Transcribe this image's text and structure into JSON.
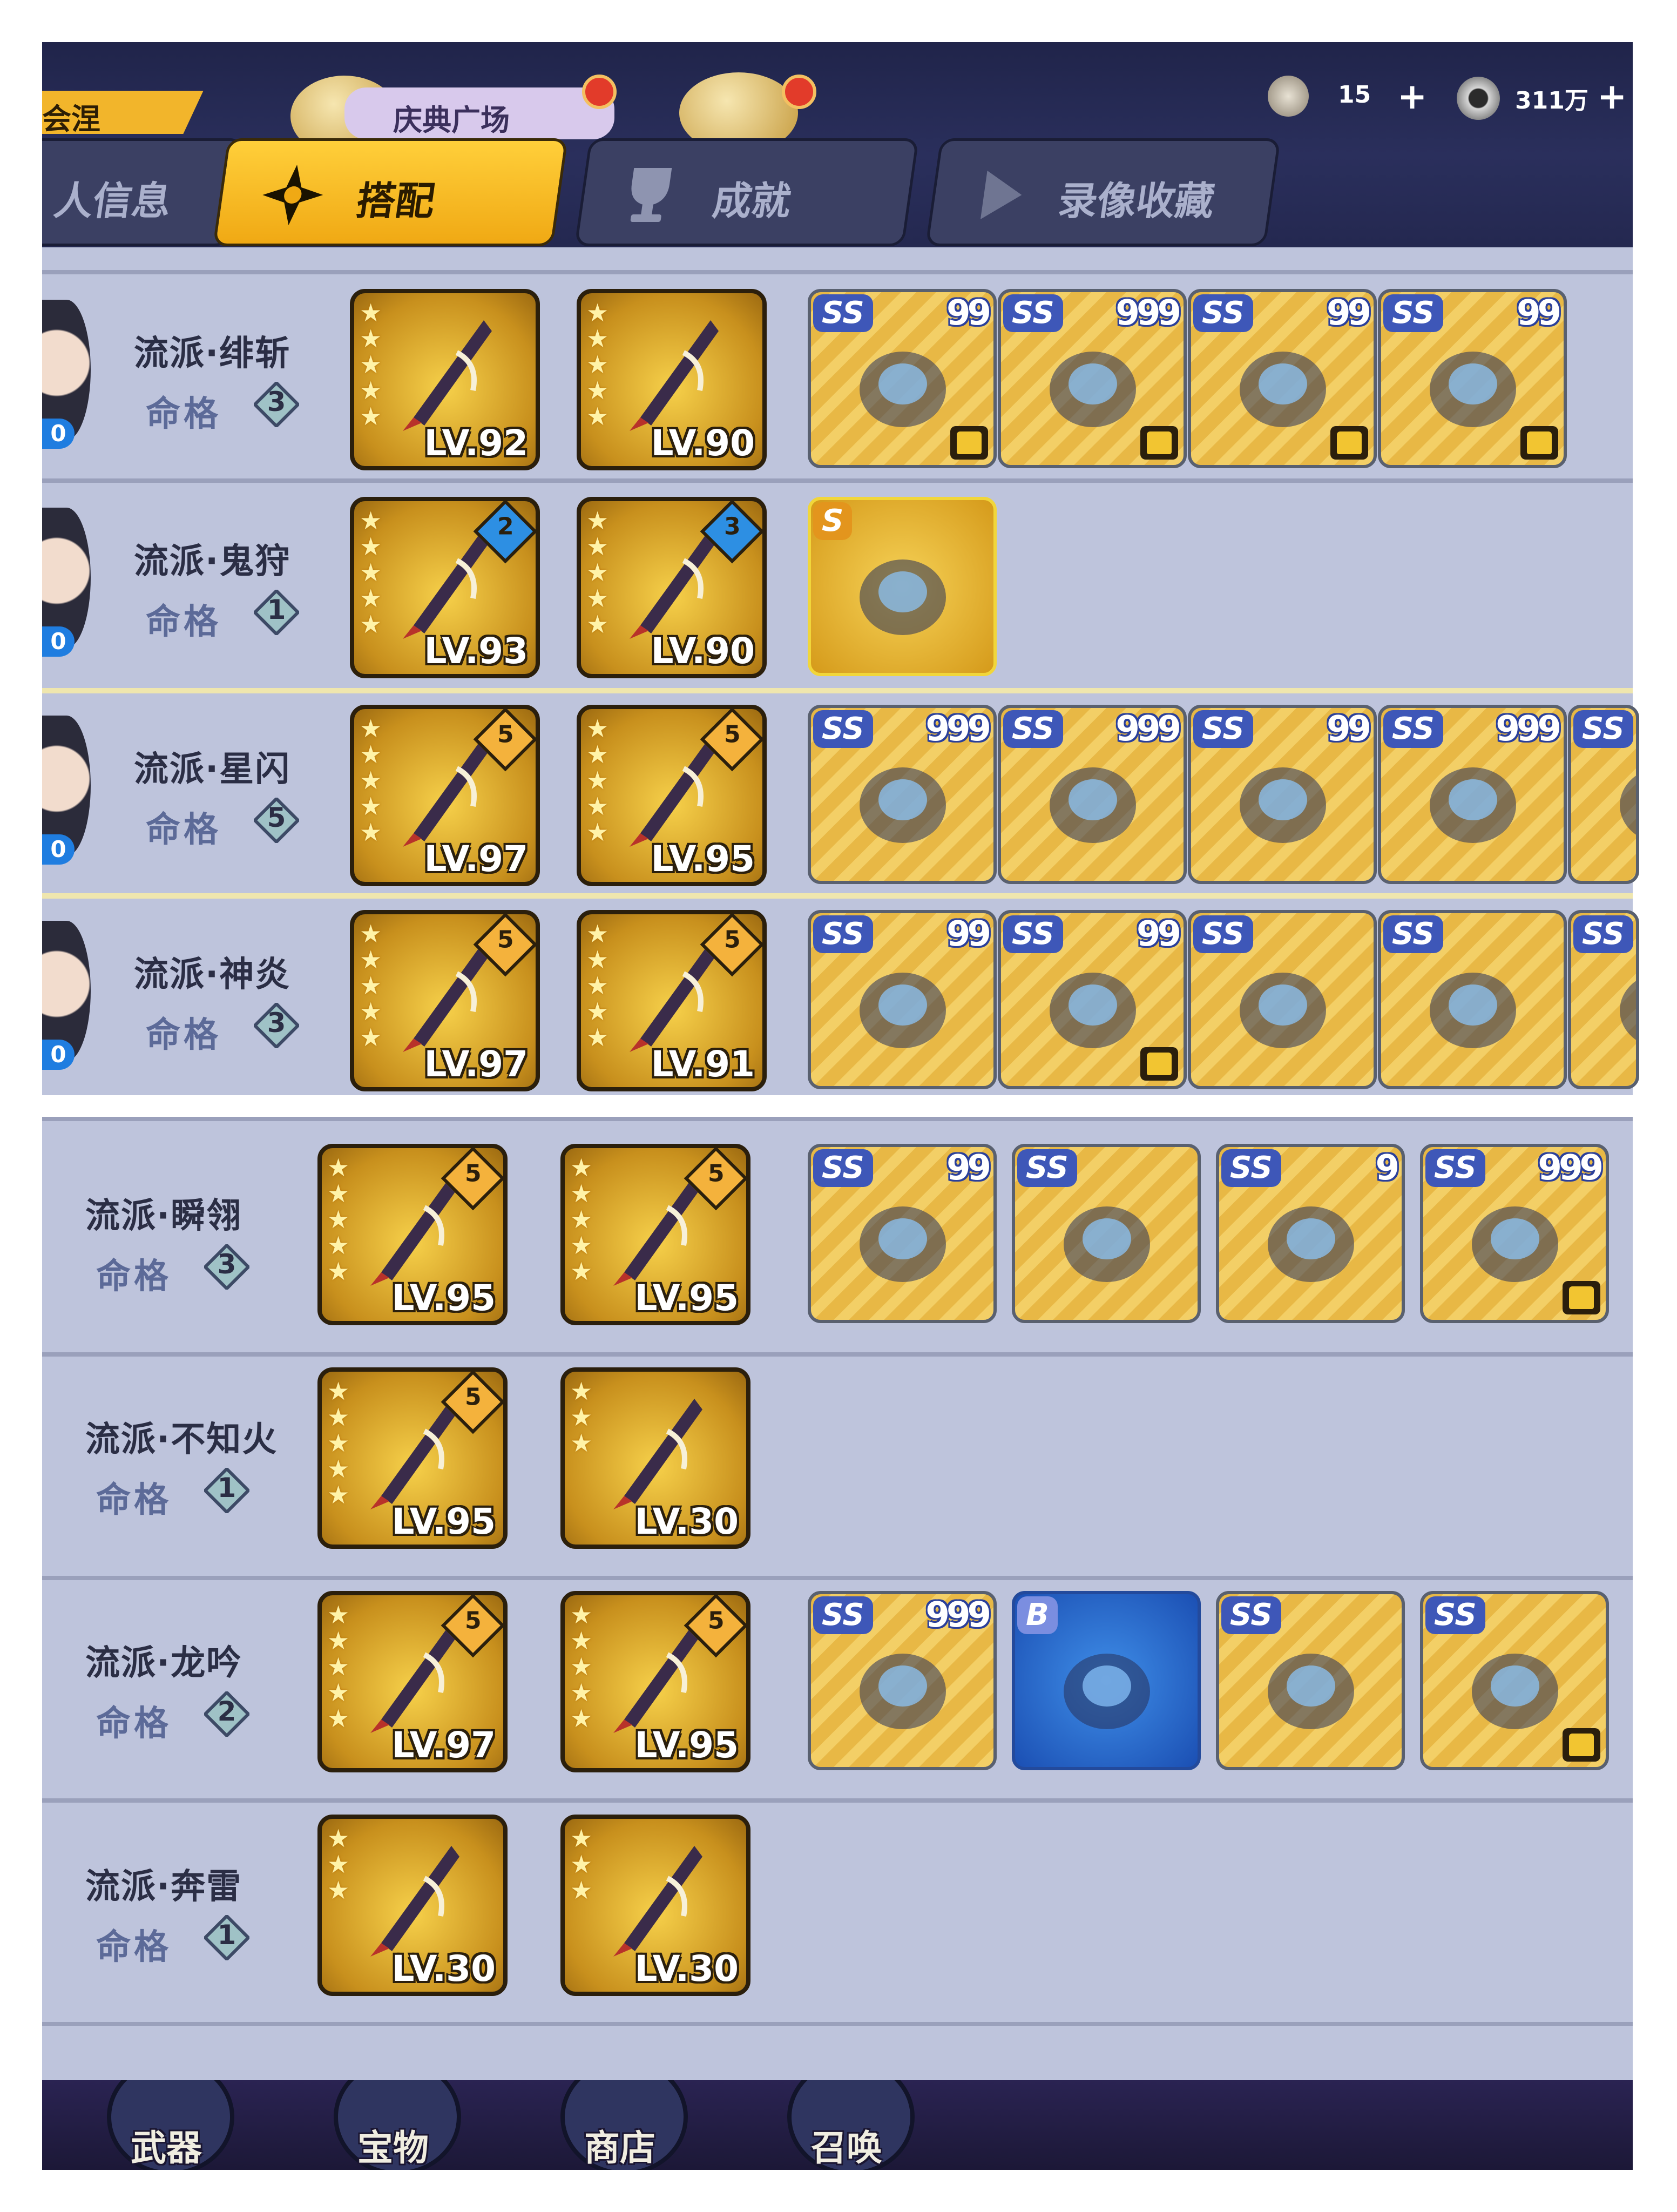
{
  "header": {
    "left_banner_text": "会涅",
    "banner_text": "庆典广场",
    "resources": [
      {
        "icon": "gem-bag-icon",
        "value": "15"
      },
      {
        "icon": "coin-icon",
        "value": "311万"
      }
    ],
    "tabs": [
      {
        "label": "人信息",
        "icon": "person-info-icon",
        "active": false
      },
      {
        "label": "搭配",
        "icon": "shuriken-icon",
        "active": true
      },
      {
        "label": "成就",
        "icon": "trophy-icon",
        "active": false
      },
      {
        "label": "录像收藏",
        "icon": "play-icon",
        "active": false
      }
    ]
  },
  "top_rows": [
    {
      "school": "流派·绯斩",
      "mingge_label": "命格",
      "mingge": "3",
      "portrait_badge": "0",
      "weapons": [
        {
          "stars": 5,
          "level": "LV.92",
          "grade": ""
        },
        {
          "stars": 5,
          "level": "LV.90",
          "grade": ""
        }
      ],
      "items": [
        {
          "grade": "SS",
          "count": "99",
          "shirt": true
        },
        {
          "grade": "SS",
          "count": "999",
          "shirt": true
        },
        {
          "grade": "SS",
          "count": "99",
          "shirt": true
        },
        {
          "grade": "SS",
          "count": "99",
          "shirt": true
        }
      ]
    },
    {
      "school": "流派·鬼狩",
      "mingge_label": "命格",
      "mingge": "1",
      "portrait_badge": "0",
      "weapons": [
        {
          "stars": 5,
          "level": "LV.93",
          "grade": "2"
        },
        {
          "stars": 5,
          "level": "LV.90",
          "grade": "3"
        }
      ],
      "items": [
        {
          "grade": "S",
          "count": "",
          "shirt": false
        }
      ]
    },
    {
      "school": "流派·星闪",
      "mingge_label": "命格",
      "mingge": "5",
      "portrait_badge": "0",
      "weapons": [
        {
          "stars": 5,
          "level": "LV.97",
          "grade": "5"
        },
        {
          "stars": 5,
          "level": "LV.95",
          "grade": "5"
        }
      ],
      "items": [
        {
          "grade": "SS",
          "count": "999",
          "shirt": false
        },
        {
          "grade": "SS",
          "count": "999",
          "shirt": false
        },
        {
          "grade": "SS",
          "count": "99",
          "shirt": false
        },
        {
          "grade": "SS",
          "count": "999",
          "shirt": false
        },
        {
          "grade": "SS",
          "count": "",
          "shirt": false
        }
      ]
    },
    {
      "school": "流派·神炎",
      "mingge_label": "命格",
      "mingge": "3",
      "portrait_badge": "0",
      "weapons": [
        {
          "stars": 5,
          "level": "LV.97",
          "grade": "5"
        },
        {
          "stars": 5,
          "level": "LV.91",
          "grade": "5"
        }
      ],
      "items": [
        {
          "grade": "SS",
          "count": "99",
          "shirt": false
        },
        {
          "grade": "SS",
          "count": "99",
          "shirt": true
        },
        {
          "grade": "SS",
          "count": "",
          "shirt": false
        },
        {
          "grade": "SS",
          "count": "",
          "shirt": false
        },
        {
          "grade": "SS",
          "count": "",
          "shirt": false
        }
      ]
    }
  ],
  "bottom_rows": [
    {
      "school": "流派·瞬翎",
      "mingge_label": "命格",
      "mingge": "3",
      "weapons": [
        {
          "stars": 5,
          "level": "LV.95",
          "grade": "5"
        },
        {
          "stars": 5,
          "level": "LV.95",
          "grade": "5"
        }
      ],
      "items": [
        {
          "grade": "SS",
          "count": "99",
          "shirt": false
        },
        {
          "grade": "SS",
          "count": "",
          "shirt": false
        },
        {
          "grade": "SS",
          "count": "9",
          "shirt": false
        },
        {
          "grade": "SS",
          "count": "999",
          "shirt": true
        }
      ]
    },
    {
      "school": "流派·不知火",
      "mingge_label": "命格",
      "mingge": "1",
      "weapons": [
        {
          "stars": 5,
          "level": "LV.95",
          "grade": "5"
        },
        {
          "stars": 3,
          "level": "LV.30",
          "grade": ""
        }
      ],
      "items": []
    },
    {
      "school": "流派·龙吟",
      "mingge_label": "命格",
      "mingge": "2",
      "weapons": [
        {
          "stars": 5,
          "level": "LV.97",
          "grade": "5"
        },
        {
          "stars": 5,
          "level": "LV.95",
          "grade": "5"
        }
      ],
      "items": [
        {
          "grade": "SS",
          "count": "999",
          "shirt": false
        },
        {
          "grade": "B",
          "count": "",
          "shirt": false
        },
        {
          "grade": "SS",
          "count": "",
          "shirt": false
        },
        {
          "grade": "SS",
          "count": "",
          "shirt": true
        }
      ]
    },
    {
      "school": "流派·奔雷",
      "mingge_label": "命格",
      "mingge": "1",
      "weapons": [
        {
          "stars": 3,
          "level": "LV.30",
          "grade": ""
        },
        {
          "stars": 3,
          "level": "LV.30",
          "grade": ""
        }
      ],
      "items": []
    }
  ],
  "nav": [
    {
      "label": "武器",
      "icon": "weapon-icon"
    },
    {
      "label": "宝物",
      "icon": "treasure-icon"
    },
    {
      "label": "商店",
      "icon": "shop-icon"
    },
    {
      "label": "召唤",
      "icon": "summon-icon"
    }
  ],
  "colors": {
    "active_tab": "#f0a914",
    "panel": "#bec4dc",
    "header": "#242850"
  }
}
